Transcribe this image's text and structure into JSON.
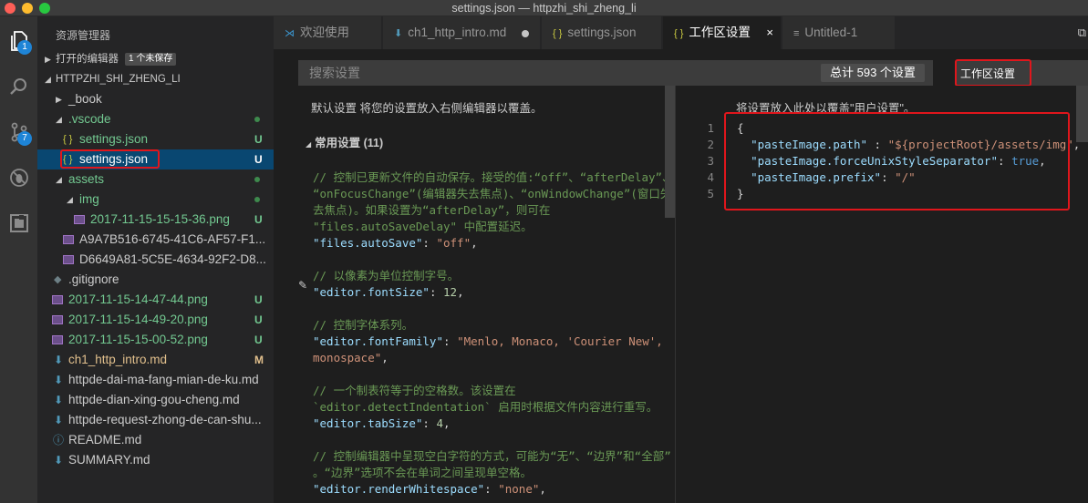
{
  "window": {
    "title": "settings.json — httpzhi_shi_zheng_li"
  },
  "activity": {
    "explorer_badge": "1",
    "scm_badge": "7"
  },
  "sidebar": {
    "title": "资源管理器",
    "open_editors": {
      "label": "打开的编辑器",
      "badge": "1 个未保存"
    },
    "root": "HTTPZHI_SHI_ZHENG_LI",
    "items": [
      {
        "label": "_book",
        "status": ""
      },
      {
        "label": ".vscode",
        "status": ""
      },
      {
        "label": "settings.json",
        "status": "U"
      },
      {
        "label": "settings.json",
        "status": "U"
      },
      {
        "label": "assets",
        "status": ""
      },
      {
        "label": "img",
        "status": ""
      },
      {
        "label": "2017-11-15-15-15-36.png",
        "status": "U"
      },
      {
        "label": "A9A7B516-6745-41C6-AF57-F1...",
        "status": ""
      },
      {
        "label": "D6649A81-5C5E-4634-92F2-D8...",
        "status": ""
      },
      {
        "label": ".gitignore",
        "status": ""
      },
      {
        "label": "2017-11-15-14-47-44.png",
        "status": "U"
      },
      {
        "label": "2017-11-15-14-49-20.png",
        "status": "U"
      },
      {
        "label": "2017-11-15-15-00-52.png",
        "status": "U"
      },
      {
        "label": "ch1_http_intro.md",
        "status": "M"
      },
      {
        "label": "httpde-dai-ma-fang-mian-de-ku.md",
        "status": ""
      },
      {
        "label": "httpde-dian-xing-gou-cheng.md",
        "status": ""
      },
      {
        "label": "httpde-request-zhong-de-can-shu...",
        "status": ""
      },
      {
        "label": "README.md",
        "status": ""
      },
      {
        "label": "SUMMARY.md",
        "status": ""
      }
    ]
  },
  "tabs": [
    {
      "label": "欢迎使用"
    },
    {
      "label": "ch1_http_intro.md"
    },
    {
      "label": "settings.json"
    },
    {
      "label": "工作区设置",
      "close": "×"
    },
    {
      "label": "Untitled-1"
    }
  ],
  "settings": {
    "search_placeholder": "搜索设置",
    "count": "总计 593 个设置",
    "scope": "工作区设置",
    "default_header": "默认设置   将您的设置放入右侧编辑器以覆盖。",
    "group": "常用设置 (11)",
    "override_header": "将设置放入此处以覆盖\"用户设置\"。"
  },
  "default_code": {
    "c1a": "// 控制已更新文件的自动保存。接受的值:“off”、“afterDelay”、",
    "c1b": "“onFocusChange”(编辑器失去焦点)、“onWindowChange”(窗口失",
    "c1c": "去焦点)。如果设置为“afterDelay”，则可在",
    "c1d": "\"files.autoSaveDelay\" 中配置延迟。",
    "k1": "\"files.autoSave\"",
    "v1": "\"off\"",
    "c2": "// 以像素为单位控制字号。",
    "k2": "\"editor.fontSize\"",
    "v2": "12",
    "c3": "// 控制字体系列。",
    "k3": "\"editor.fontFamily\"",
    "v3a": "\"Menlo, Monaco, 'Courier New',",
    "v3b": "monospace\"",
    "c4a": "// 一个制表符等于的空格数。该设置在",
    "c4b": "`editor.detectIndentation` 启用时根据文件内容进行重写。",
    "k4": "\"editor.tabSize\"",
    "v4": "4",
    "c5a": "// 控制编辑器中呈现空白字符的方式，可能为“无”、“边界”和“全部”",
    "c5b": "。“边界”选项不会在单词之间呈现单空格。",
    "k5": "\"editor.renderWhitespace\"",
    "v5": "\"none\""
  },
  "workspace_code": {
    "line_numbers": [
      "1",
      "2",
      "3",
      "4",
      "5"
    ],
    "k1": "\"pasteImage.path\"",
    "v1": "\"${projectRoot}/assets/img\"",
    "k2": "\"pasteImage.forceUnixStyleSeparator\"",
    "v2": "true",
    "k3": "\"pasteImage.prefix\"",
    "v3": "\"/\""
  },
  "colors": {
    "accent_badge": "#1e84d6",
    "highlight_red": "#e0161c",
    "git_untracked": "#73c991",
    "git_modified": "#e2c08d"
  }
}
